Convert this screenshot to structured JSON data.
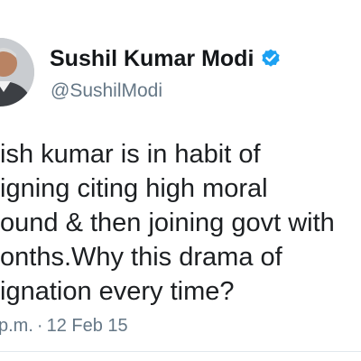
{
  "tweet": {
    "display_name": "Sushil Kumar Modi",
    "verified_icon": "verified-badge-icon",
    "handle": "@SushilModi",
    "text_lines": [
      "ish kumar is in habit of",
      "igning  citing high moral",
      "ound & then joining govt with",
      "onths.Why this drama of",
      "ignation every time?"
    ],
    "time": "p.m.",
    "separator": "·",
    "date": "12 Feb 15"
  },
  "colors": {
    "verified_badge": "#1da1f2",
    "secondary_text": "#657786",
    "primary_text": "#14171a"
  }
}
